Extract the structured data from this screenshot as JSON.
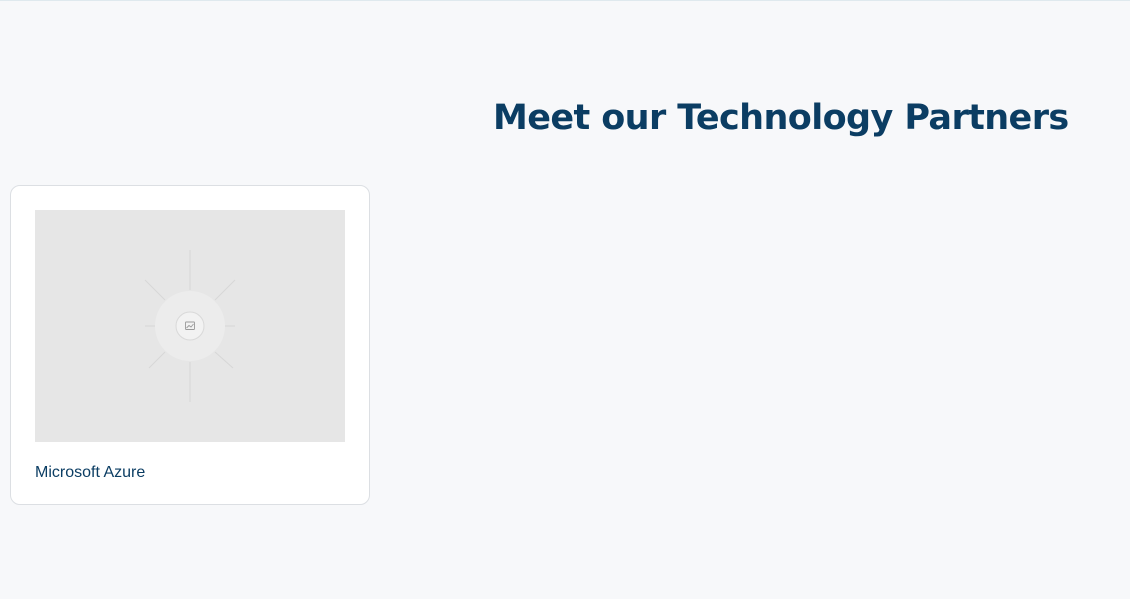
{
  "section": {
    "title": "Meet our Technology Partners"
  },
  "partners": [
    {
      "name": "Microsoft Azure",
      "image_icon": "image-placeholder-icon"
    }
  ],
  "colors": {
    "background": "#f7f8fa",
    "heading": "#0b3d63",
    "card_background": "#ffffff",
    "card_border": "#dcdfe3",
    "image_placeholder": "#e6e6e6"
  }
}
